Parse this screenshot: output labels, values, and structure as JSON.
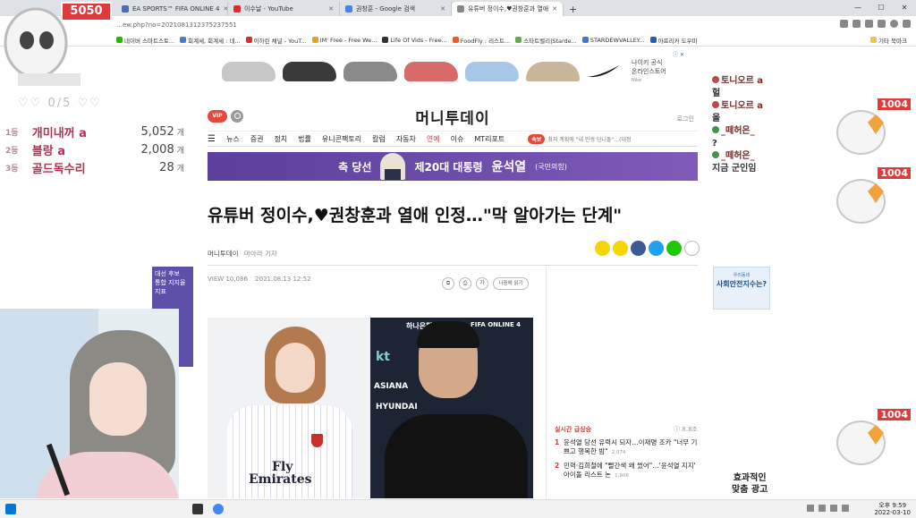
{
  "browser": {
    "tabs": [
      {
        "label": "EA SPORTS™ FIFA ONLINE 4",
        "color": "#4b6cb7"
      },
      {
        "label": "이수날 - YouTube",
        "color": "#e02b2b"
      },
      {
        "label": "권창훈 - Google 검색",
        "color": "#4285f4"
      },
      {
        "label": "유튜버 정이수,♥권창훈과 열애",
        "color": "#888888",
        "active": true
      }
    ],
    "new_tab": "+",
    "window_controls": [
      "—",
      "☐",
      "✕"
    ],
    "url": "…ew.php?no=2021081312375237551",
    "bookmarks": [
      "네이버 스마트스토...",
      "회계세, 회계세 : 네...",
      "이하린 채널 - YouT...",
      "IM' Free - Free We...",
      "Life Of Vids - Free...",
      "FoodFly : 리스트...",
      "스타트벨리|Starde...",
      "STARDEWVALLEY...",
      "아프리카 도우미",
      "기타 북마크"
    ]
  },
  "overlay": {
    "donation_count": "5050",
    "hearts": "♡♡ 0/5 ♡♡",
    "ranks": [
      {
        "pos": "1등",
        "name": "개미내꺼 a",
        "count": "5,052",
        "unit": "개"
      },
      {
        "pos": "2등",
        "name": "블랑 a",
        "count": "2,008",
        "unit": "개"
      },
      {
        "pos": "3등",
        "name": "골드독수리",
        "count": "28",
        "unit": "개"
      }
    ],
    "chat": [
      "토니오르 a",
      "헐",
      "토니오르 a",
      "올",
      "_떼허은_",
      "?",
      "_떼허은_",
      "지금 군인임"
    ],
    "fan_numbers": [
      "1004",
      "1004",
      "1004"
    ],
    "right_ad_text": [
      "효과적인",
      "맞춤 광고"
    ]
  },
  "ad_banner": {
    "tag": "ⓘ ✕",
    "text_lines": [
      "나이키 공식",
      "온라인스토어",
      "Nike"
    ],
    "shoe_colors": [
      "#c7c7c7",
      "#3a3a3a",
      "#8a8a8a",
      "#d96a6a",
      "#a9c7e8",
      "#c9b69a"
    ]
  },
  "site": {
    "vip": "VIP",
    "logo": "머니투데이",
    "login": "로그인",
    "nav": [
      "뉴스",
      "증권",
      "정치",
      "법률",
      "유니콘팩토리",
      "칼럼",
      "자동차",
      "연예",
      "이슈",
      "MT리포트"
    ],
    "breaking_label": "속보",
    "breaking_text": "최저 계획에 \"내 인생 단니돌\"…(대정"
  },
  "election": {
    "prefix": "축 당선",
    "title": "제20대 대통령",
    "name": "윤석열",
    "party": "(국민의힘)"
  },
  "article": {
    "headline": "유튜버 정이수,♥권창훈과 열애 인정…\"막 알아가는 단계\"",
    "source": "머니투데이",
    "reporter": "마아라 기자",
    "views": "VIEW 10,086",
    "date": "2021.08.13 12:52",
    "tool_font": "가",
    "tool_later": "나중에 읽기",
    "photo_words": [
      "Fly",
      "Emirates",
      "kt",
      "ASIANA",
      "HYUNDAI",
      "하나은행",
      "FIFA ONLINE 4"
    ]
  },
  "side_ad": {
    "small": "우리동네",
    "text": "사회안전지수는?"
  },
  "left_ad": {
    "lines": [
      "대선 후보",
      "통합 지지율",
      "지표"
    ]
  },
  "realtime": {
    "title": "실시간 급상승",
    "sub": "ⓘ 8.8조",
    "items": [
      {
        "n": "1",
        "text": "윤석열 당선 유력시 되자…이재명 조카 \"너무 기쁘고 행복한 밤\"",
        "meta": "2,074"
      },
      {
        "n": "2",
        "text": "민혁·김희철에 \"빨간색 왜 썼어\"…'윤석열 지지' 아이돌 리스트 논",
        "meta": "1,906"
      }
    ]
  },
  "taskbar": {
    "clock_line1": "오후 9:59",
    "clock_line2": "2022-03-10"
  }
}
